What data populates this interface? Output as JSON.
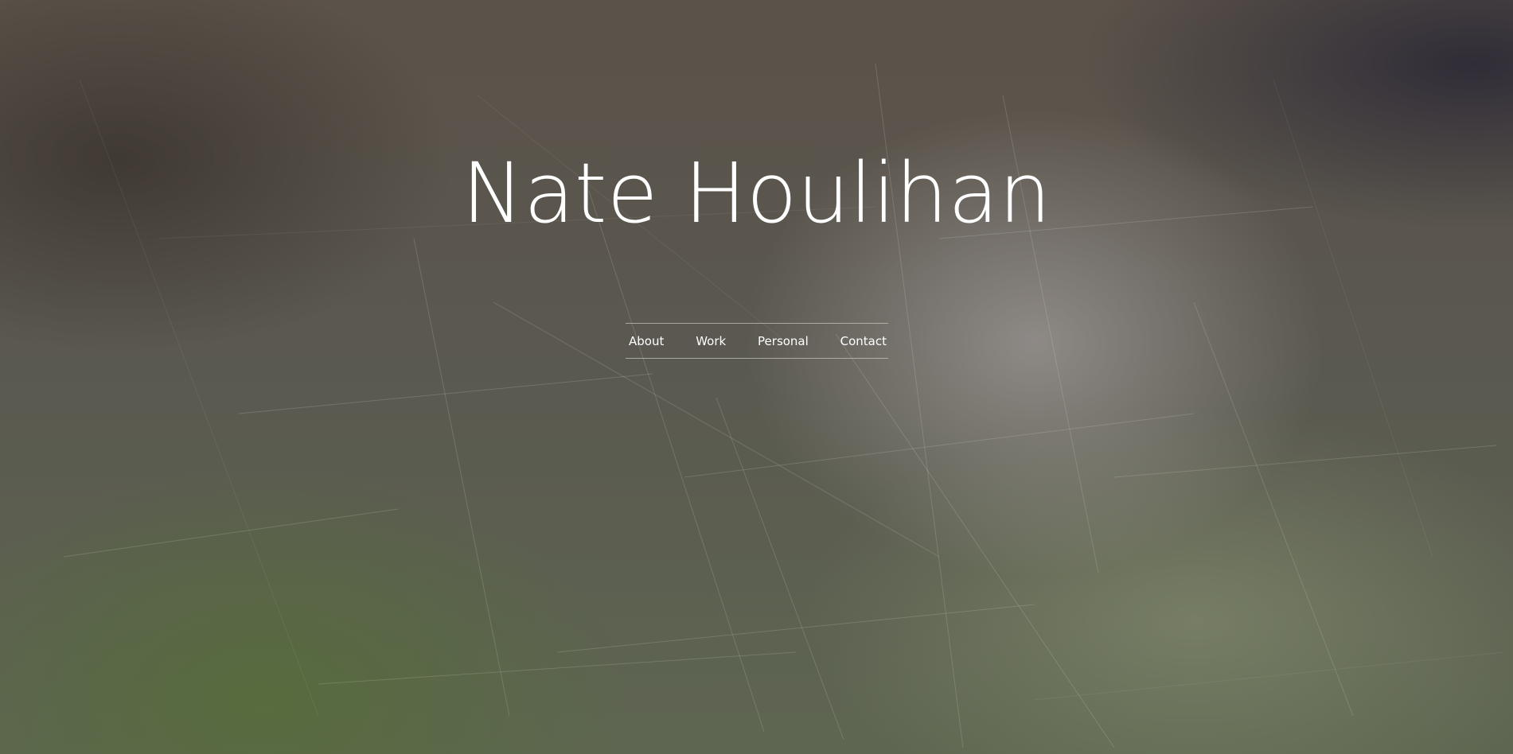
{
  "header": {
    "title": "Nate Houlihan"
  },
  "nav": {
    "items": [
      {
        "label": "About"
      },
      {
        "label": "Work"
      },
      {
        "label": "Personal"
      },
      {
        "label": "Contact"
      }
    ]
  },
  "colors": {
    "text": "#ffffff",
    "background_base": "#5d5a52",
    "background_green": "#556e37",
    "background_highlight": "#b9b2b2",
    "nav_rule": "#d2d2c8"
  }
}
